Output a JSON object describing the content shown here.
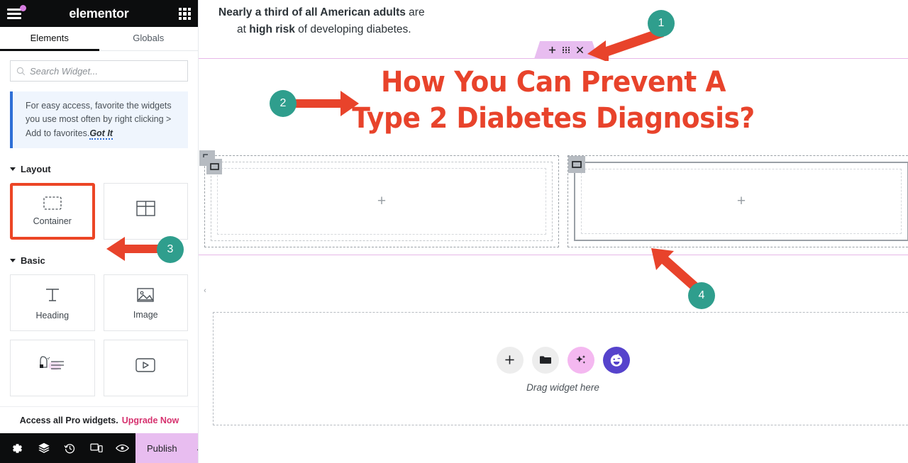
{
  "panel": {
    "brand": "elementor",
    "menu_icon": "hamburger-menu-icon",
    "apps_icon": "apps-grid-icon",
    "tabs": [
      {
        "label": "Elements",
        "active": true
      },
      {
        "label": "Globals",
        "active": false
      }
    ],
    "search": {
      "placeholder": "Search Widget...",
      "value": "",
      "icon": "search-icon"
    },
    "notice": {
      "text": "For easy access, favorite the widgets you use most often by right clicking > Add to favorites.",
      "action": "Got It",
      "accent_color": "#2f6fd6",
      "background": "#eff5fd"
    },
    "sections": [
      {
        "title": "Layout",
        "widgets": [
          {
            "label": "Container",
            "icon": "container-icon",
            "highlighted": true
          },
          {
            "label": "",
            "icon": "grid-icon",
            "highlighted": false
          }
        ]
      },
      {
        "title": "Basic",
        "widgets": [
          {
            "label": "Heading",
            "icon": "heading-text-icon",
            "highlighted": false
          },
          {
            "label": "Image",
            "icon": "image-icon",
            "highlighted": false
          },
          {
            "label": "",
            "icon": "text-editor-icon",
            "highlighted": false
          },
          {
            "label": "",
            "icon": "video-play-icon",
            "highlighted": false
          }
        ]
      }
    ],
    "pro_bar": {
      "text": "Access all Pro widgets.",
      "link": "Upgrade Now",
      "link_color": "#d6316e"
    },
    "bottom_bar": {
      "icons": [
        "settings-gear-icon",
        "navigator-layers-icon",
        "history-clock-icon",
        "responsive-devices-icon",
        "preview-eye-icon"
      ],
      "publish_label": "Publish",
      "publish_color": "#e8bdf0",
      "publish_caret_icon": "chevron-up-icon"
    }
  },
  "canvas": {
    "intro": {
      "line1_bold": "Nearly a third of all American adults",
      "line1_rest": " are",
      "line2_pre": "at ",
      "line2_bold": "high risk",
      "line2_rest": " of developing diabetes."
    },
    "container_toolbar": {
      "add_icon": "plus-icon",
      "drag_icon": "drag-handle-dots-icon",
      "close_icon": "close-x-icon",
      "background": "#e8bdf0"
    },
    "headline": {
      "line1": "How You Can Prevent A",
      "line2": "Type 2 Diabetes Diagnosis?",
      "color": "#e8432b"
    },
    "collapse_icon": "chevron-left-icon",
    "drop_zones": [
      {
        "name": "left-container",
        "plus_icon": "plus-icon",
        "selected": false
      },
      {
        "name": "right-container",
        "plus_icon": "plus-icon",
        "selected": true
      }
    ],
    "drag_widget": {
      "label": "Drag widget here",
      "buttons": [
        {
          "icon": "plus-icon",
          "style": "gray"
        },
        {
          "icon": "folder-icon",
          "style": "gray"
        },
        {
          "icon": "ai-sparkles-icon",
          "style": "pink"
        },
        {
          "icon": "ai-assistant-face-icon",
          "style": "purple"
        }
      ]
    }
  },
  "annotations": {
    "marker_color": "#2f9e8d",
    "arrow_color": "#e8432b",
    "markers": [
      {
        "number": "1",
        "target": "container-toolbar"
      },
      {
        "number": "2",
        "target": "headline"
      },
      {
        "number": "3",
        "target": "container-widget"
      },
      {
        "number": "4",
        "target": "container-bottom-edge"
      }
    ]
  }
}
